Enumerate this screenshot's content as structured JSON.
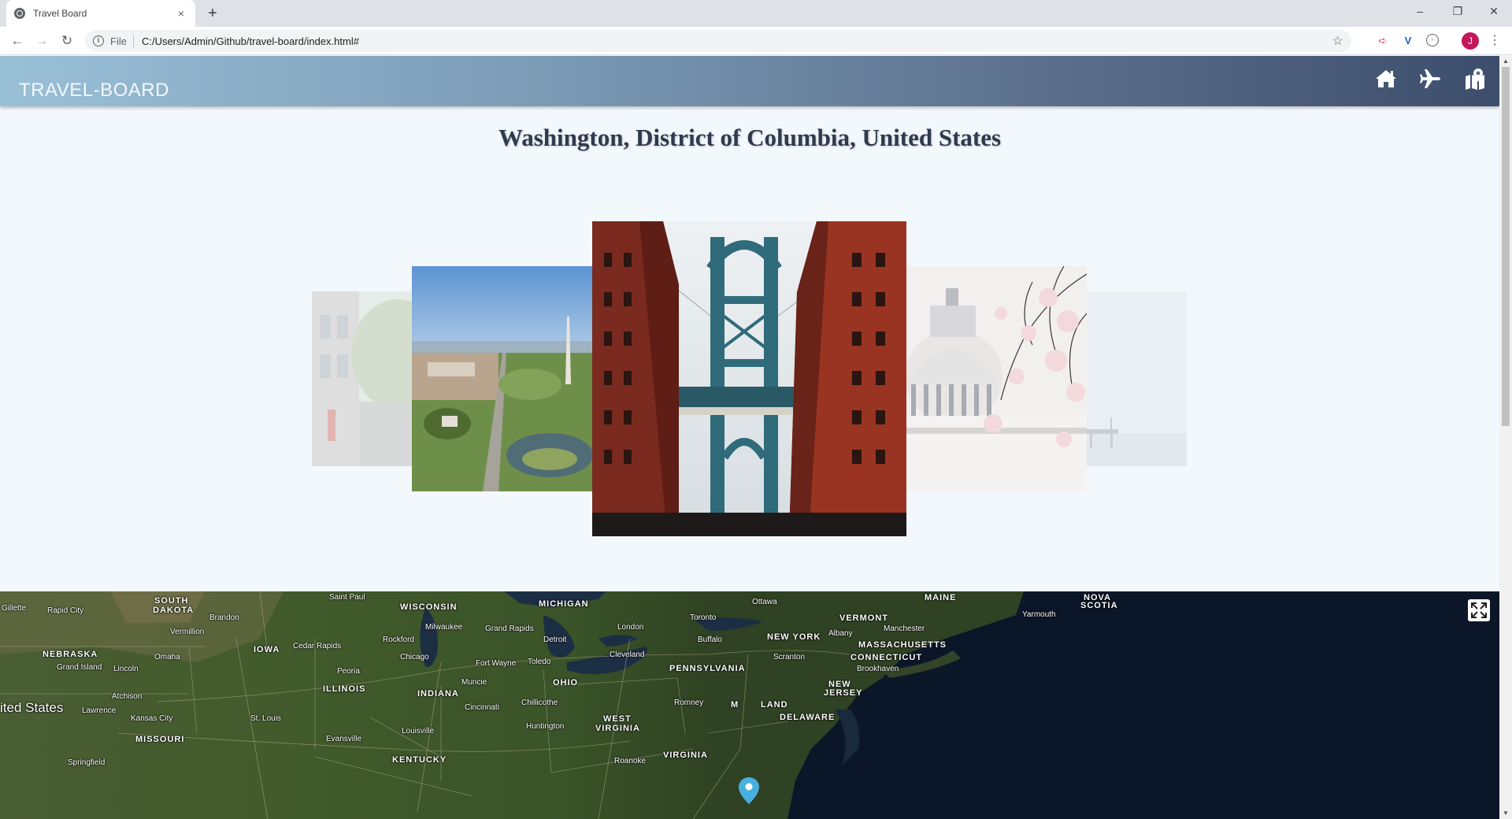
{
  "browser": {
    "tab_title": "Travel Board",
    "tab_close": "×",
    "new_tab": "+",
    "url_scheme": "File",
    "url": "C:/Users/Admin/Github/travel-board/index.html#",
    "profile_initial": "J",
    "window_controls": {
      "minimize": "–",
      "restore": "❐",
      "close": "✕"
    }
  },
  "app": {
    "brand": "TRAVEL-BOARD",
    "nav_icons": [
      "home-icon",
      "plane-icon",
      "map-marked-icon"
    ],
    "page_title": "Washington, District of Columbia, United States",
    "carousel": {
      "slides": [
        "street-row-houses",
        "washington-monument-aerial",
        "manhattan-bridge-brick-buildings",
        "us-capitol-cherry-blossoms",
        "harbor-pier"
      ],
      "active_index": 2
    },
    "map": {
      "labels": [
        {
          "text": "Gillette",
          "type": "city"
        },
        {
          "text": "Rapid City",
          "type": "city"
        },
        {
          "text": "SOUTH",
          "type": "state"
        },
        {
          "text": "DAKOTA",
          "type": "state"
        },
        {
          "text": "Brandon",
          "type": "city"
        },
        {
          "text": "Saint Paul",
          "type": "city"
        },
        {
          "text": "WISCONSIN",
          "type": "state"
        },
        {
          "text": "MICHIGAN",
          "type": "state"
        },
        {
          "text": "Ottawa",
          "type": "city"
        },
        {
          "text": "MAINE",
          "type": "state"
        },
        {
          "text": "NOVA",
          "type": "state"
        },
        {
          "text": "SCOTIA",
          "type": "state"
        },
        {
          "text": "Yarmouth",
          "type": "city"
        },
        {
          "text": "Vermillion",
          "type": "city"
        },
        {
          "text": "Milwaukee",
          "type": "city"
        },
        {
          "text": "Grand Rapids",
          "type": "city"
        },
        {
          "text": "Toronto",
          "type": "city"
        },
        {
          "text": "VERMONT",
          "type": "state"
        },
        {
          "text": "London",
          "type": "city"
        },
        {
          "text": "Manchester",
          "type": "city"
        },
        {
          "text": "NEBRASKA",
          "type": "state"
        },
        {
          "text": "IOWA",
          "type": "state"
        },
        {
          "text": "Cedar Rapids",
          "type": "city"
        },
        {
          "text": "Rockford",
          "type": "city"
        },
        {
          "text": "Detroit",
          "type": "city"
        },
        {
          "text": "Buffalo",
          "type": "city"
        },
        {
          "text": "NEW YORK",
          "type": "state"
        },
        {
          "text": "Albany",
          "type": "city"
        },
        {
          "text": "MASSACHUSETTS",
          "type": "state"
        },
        {
          "text": "Omaha",
          "type": "city"
        },
        {
          "text": "Chicago",
          "type": "city"
        },
        {
          "text": "Cleveland",
          "type": "city"
        },
        {
          "text": "Scranton",
          "type": "city"
        },
        {
          "text": "CONNECTICUT",
          "type": "state"
        },
        {
          "text": "Grand Island",
          "type": "city"
        },
        {
          "text": "Lincoln",
          "type": "city"
        },
        {
          "text": "Fort Wayne",
          "type": "city"
        },
        {
          "text": "Toledo",
          "type": "city"
        },
        {
          "text": "PENNSYLVANIA",
          "type": "state"
        },
        {
          "text": "Brookhaven",
          "type": "city"
        },
        {
          "text": "Peoria",
          "type": "city"
        },
        {
          "text": "Muncie",
          "type": "city"
        },
        {
          "text": "OHIO",
          "type": "state"
        },
        {
          "text": "ILLINOIS",
          "type": "state"
        },
        {
          "text": "NEW",
          "type": "state"
        },
        {
          "text": "JERSEY",
          "type": "state"
        },
        {
          "text": "Atchison",
          "type": "city"
        },
        {
          "text": "INDIANA",
          "type": "state"
        },
        {
          "text": "Chillicothe",
          "type": "city"
        },
        {
          "text": "Romney",
          "type": "city"
        },
        {
          "text": "M",
          "type": "state"
        },
        {
          "text": "LAND",
          "type": "state"
        },
        {
          "text": "ited States",
          "type": "country"
        },
        {
          "text": "Lawrence",
          "type": "city"
        },
        {
          "text": "Cincinnati",
          "type": "city"
        },
        {
          "text": "DELAWARE",
          "type": "state"
        },
        {
          "text": "Kansas City",
          "type": "city"
        },
        {
          "text": "St. Louis",
          "type": "city"
        },
        {
          "text": "WEST",
          "type": "state"
        },
        {
          "text": "VIRGINIA",
          "type": "state"
        },
        {
          "text": "Huntington",
          "type": "city"
        },
        {
          "text": "Louisville",
          "type": "city"
        },
        {
          "text": "MISSOURI",
          "type": "state"
        },
        {
          "text": "Evansville",
          "type": "city"
        },
        {
          "text": "VIRGINIA",
          "type": "state"
        },
        {
          "text": "KENTUCKY",
          "type": "state"
        },
        {
          "text": "Roanoke",
          "type": "city"
        },
        {
          "text": "Springfield",
          "type": "city"
        }
      ]
    }
  }
}
